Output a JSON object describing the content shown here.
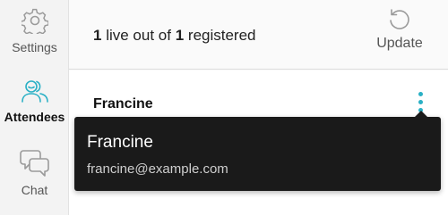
{
  "sidebar": {
    "items": [
      {
        "label": "Settings",
        "icon": "gear-icon",
        "active": false
      },
      {
        "label": "Attendees",
        "icon": "attendees-icon",
        "active": true
      },
      {
        "label": "Chat",
        "icon": "chat-icon",
        "active": false
      }
    ]
  },
  "header": {
    "live_count": "1",
    "text_live_out_of": "live out of",
    "registered_count": "1",
    "text_registered": "registered",
    "update_label": "Update",
    "update_icon": "refresh-icon"
  },
  "attendees": [
    {
      "name": "Francine",
      "menu_icon": "kebab-menu-icon"
    }
  ],
  "tooltip": {
    "name": "Francine",
    "email": "francine@example.com"
  },
  "colors": {
    "accent": "#2ab0c5",
    "tooltip_bg": "#1a1a1a",
    "sidebar_bg": "#f3f3f3"
  }
}
